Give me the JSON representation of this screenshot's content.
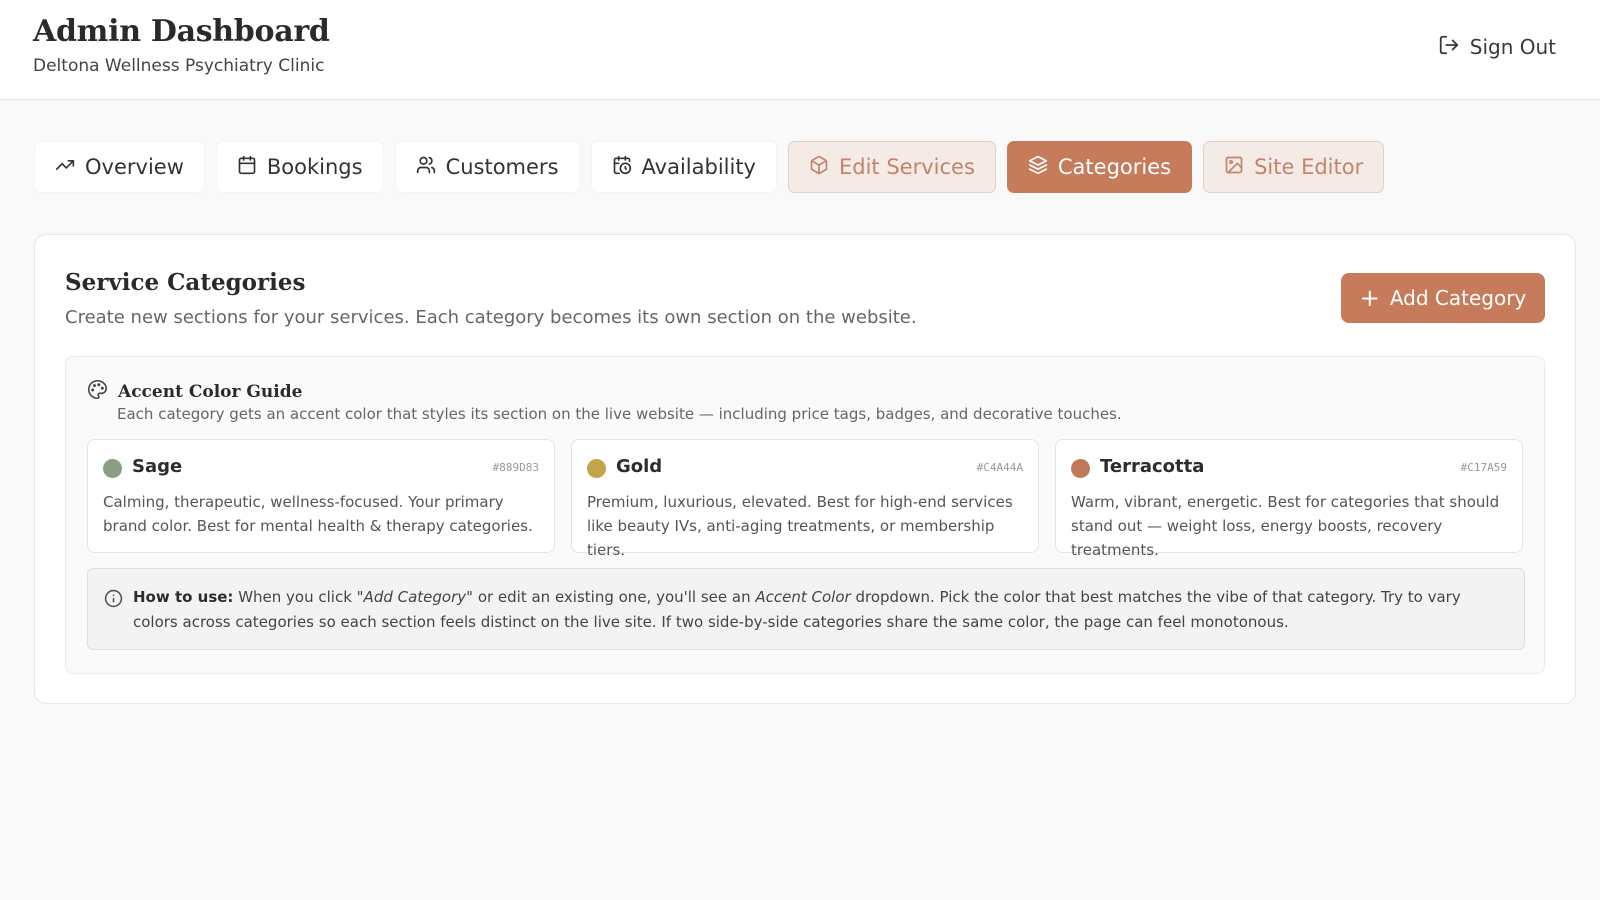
{
  "header": {
    "title": "Admin Dashboard",
    "subtitle": "Deltona Wellness Psychiatry Clinic",
    "sign_out": "Sign Out"
  },
  "tabs": [
    {
      "label": "Overview",
      "icon": "trending-up-icon",
      "state": "normal"
    },
    {
      "label": "Bookings",
      "icon": "calendar-icon",
      "state": "normal"
    },
    {
      "label": "Customers",
      "icon": "users-icon",
      "state": "normal"
    },
    {
      "label": "Availability",
      "icon": "calendar-clock-icon",
      "state": "normal"
    },
    {
      "label": "Edit Services",
      "icon": "package-icon",
      "state": "soft"
    },
    {
      "label": "Categories",
      "icon": "layers-icon",
      "state": "active"
    },
    {
      "label": "Site Editor",
      "icon": "image-icon",
      "state": "soft"
    }
  ],
  "categories": {
    "title": "Service Categories",
    "description": "Create new sections for your services. Each category becomes its own section on the website.",
    "add_button": "Add Category"
  },
  "guide": {
    "title": "Accent Color Guide",
    "description": "Each category gets an accent color that styles its section on the live website — including price tags, badges, and decorative touches.",
    "colors": [
      {
        "name": "Sage",
        "hex": "#889D83",
        "color": "#889D83",
        "text": "Calming, therapeutic, wellness-focused. Your primary brand color. Best for mental health & therapy categories."
      },
      {
        "name": "Gold",
        "hex": "#C4A44A",
        "color": "#C4A44A",
        "text": "Premium, luxurious, elevated. Best for high-end services like beauty IVs, anti-aging treatments, or membership tiers."
      },
      {
        "name": "Terracotta",
        "hex": "#C17A59",
        "color": "#C17A59",
        "text": "Warm, vibrant, energetic. Best for categories that should stand out — weight loss, energy boosts, recovery treatments."
      }
    ],
    "howto": {
      "label": "How to use:",
      "part1": " When you click ",
      "em1": "\"Add Category\"",
      "part2": " or edit an existing one, you'll see an ",
      "em2": "Accent Color",
      "part3": " dropdown. Pick the color that best matches the vibe of that category. Try to vary colors across categories so each section feels distinct on the live site. If two side-by-side categories share the same color, the page can feel monotonous."
    }
  },
  "colors": {
    "accent": "#c67b5b",
    "accent_soft_bg": "#f4ebe7"
  }
}
